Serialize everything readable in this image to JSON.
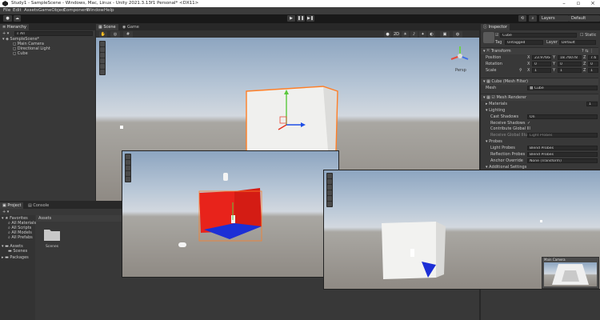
{
  "window": {
    "title": "Study1 - SampleScene - Windows, Mac, Linux - Unity 2021.3.13f1 Personal* <DX11>"
  },
  "menu": [
    "File",
    "Edit",
    "Assets",
    "GameObject",
    "Component",
    "Window",
    "Help"
  ],
  "toolbar": {
    "layers": "Layers",
    "layout": "Default"
  },
  "hierarchy": {
    "tab": "Hierarchy",
    "search": "All",
    "scene": "SampleScene*",
    "items": [
      "Main Camera",
      "Directional Light",
      "Cube"
    ]
  },
  "scene_view": {
    "tab_scene": "Scene",
    "tab_game": "Game",
    "persp_label": "Persp"
  },
  "project": {
    "tab_project": "Project",
    "tab_console": "Console",
    "favorites": "Favorites",
    "fav_items": [
      "All Materials",
      "All Models",
      "All Prefabs"
    ],
    "fav_items2": [
      "All Scripts"
    ],
    "assets": "Assets",
    "asset_children": [
      "Scenes"
    ],
    "packages": "Packages",
    "breadcrumb": "Assets",
    "folder": "Scenes"
  },
  "inspector": {
    "tab": "Inspector",
    "object_name": "Cube",
    "static_label": "Static",
    "tag_label": "Tag",
    "tag_value": "Untagged",
    "layer_label": "Layer",
    "layer_value": "Default",
    "transform": {
      "title": "Transform",
      "position_label": "Position",
      "rotation_label": "Rotation",
      "scale_label": "Scale",
      "pos": {
        "x": "23.97664",
        "y": "18.76078",
        "z": "7.6"
      },
      "rot": {
        "x": "0",
        "y": "0",
        "z": "0"
      },
      "scl": {
        "x": "1",
        "y": "1",
        "z": "1"
      }
    },
    "mesh_filter": {
      "title": "Cube (Mesh Filter)",
      "mesh_label": "Mesh",
      "mesh_value": "Cube"
    },
    "mesh_renderer": {
      "title": "Mesh Renderer",
      "materials": "Materials",
      "materials_count": "1",
      "lighting": "Lighting",
      "cast_shadows": "Cast Shadows",
      "cast_shadows_val": "On",
      "receive_shadows": "Receive Shadows",
      "contribute_gi": "Contribute Global Ill",
      "receive_gi": "Receive Global Illum",
      "receive_gi_val": "Light Probes",
      "probes": "Probes",
      "light_probes": "Light Probes",
      "light_probes_val": "Blend Probes",
      "reflection_probes": "Reflection Probes",
      "reflection_probes_val": "Blend Probes",
      "anchor_override": "Anchor Override",
      "anchor_override_val": "None (Transform)",
      "additional": "Additional Settings"
    }
  },
  "camera_preview": {
    "title": "Main Camera"
  },
  "colors": {
    "accent": "#ff7f27",
    "selection": "#2c5d87",
    "red_cube": "#e8231b",
    "blue_floor": "#1c2fd6"
  }
}
